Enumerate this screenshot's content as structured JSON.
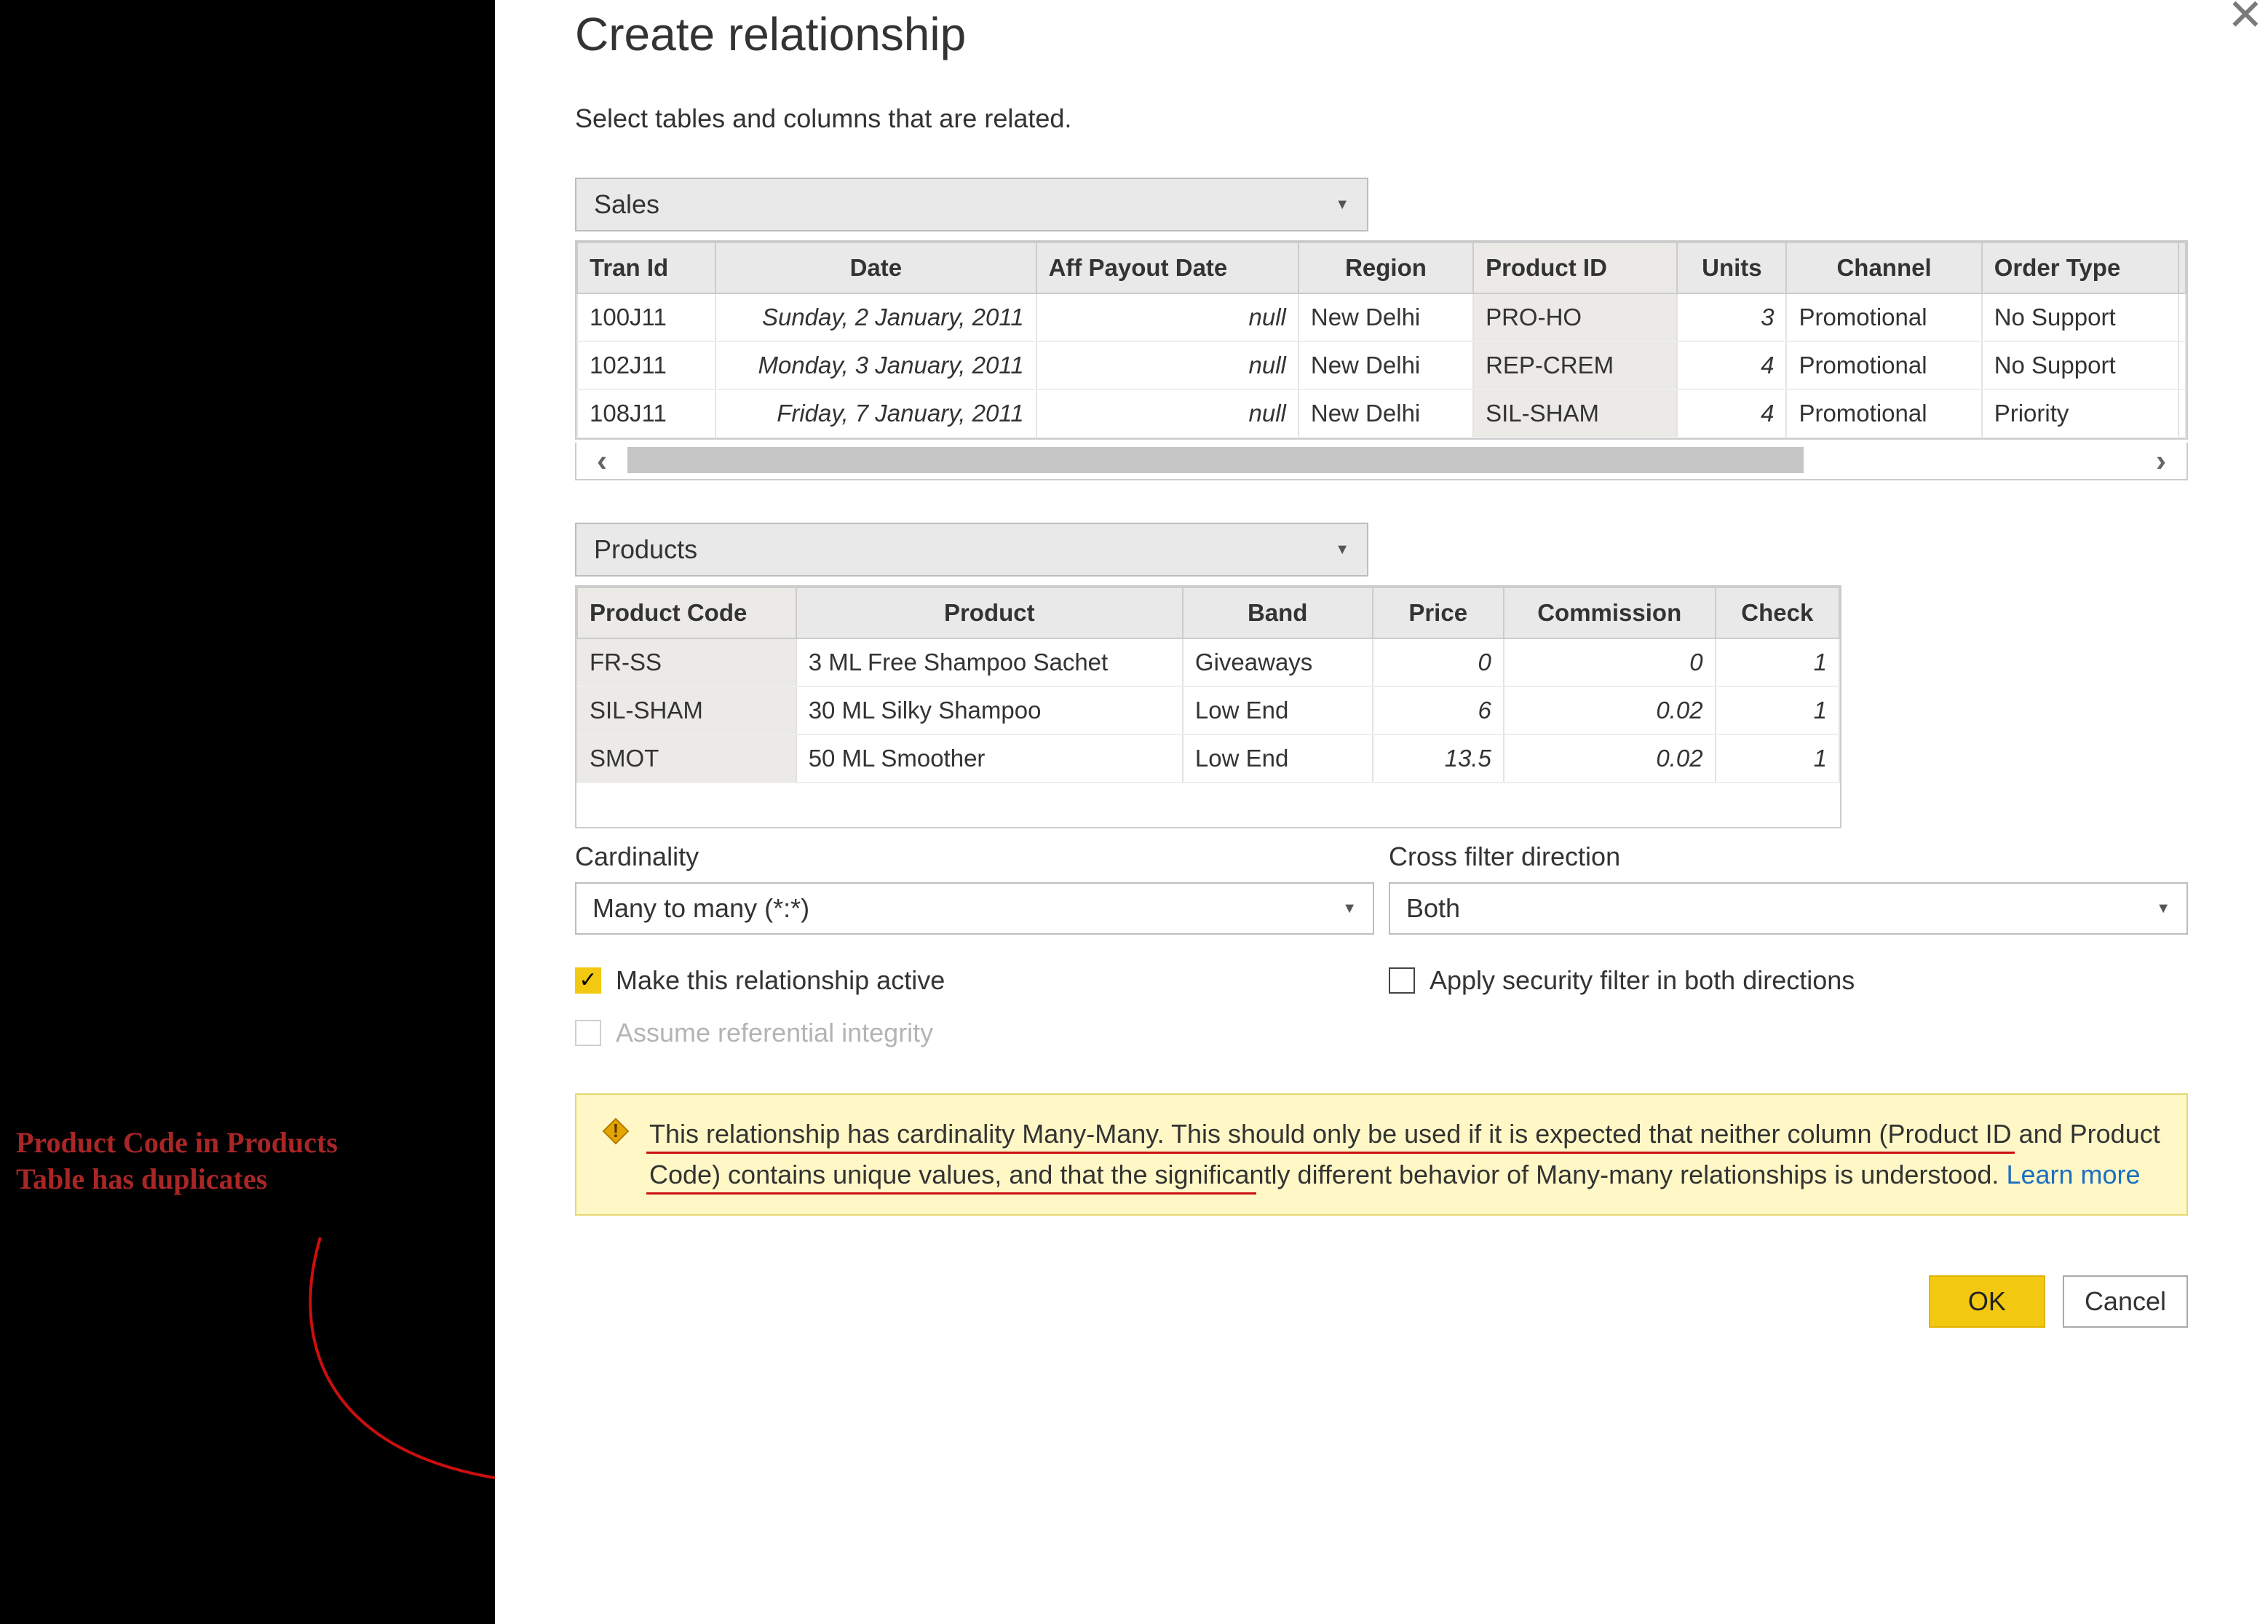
{
  "dialog": {
    "title": "Create relationship",
    "subtitle": "Select tables and columns that are related.",
    "close": "✕"
  },
  "table1": {
    "name": "Sales",
    "headers": [
      "Tran Id",
      "Date",
      "Aff Payout Date",
      "Region",
      "Product ID",
      "Units",
      "Channel",
      "Order Type"
    ],
    "rows": [
      {
        "id": "100J11",
        "date": "Sunday, 2 January, 2011",
        "aff": "null",
        "region": "New Delhi",
        "pid": "PRO-HO",
        "units": "3",
        "channel": "Promotional",
        "otype": "No Support"
      },
      {
        "id": "102J11",
        "date": "Monday, 3 January, 2011",
        "aff": "null",
        "region": "New Delhi",
        "pid": "REP-CREM",
        "units": "4",
        "channel": "Promotional",
        "otype": "No Support"
      },
      {
        "id": "108J11",
        "date": "Friday, 7 January, 2011",
        "aff": "null",
        "region": "New Delhi",
        "pid": "SIL-SHAM",
        "units": "4",
        "channel": "Promotional",
        "otype": "Priority"
      }
    ]
  },
  "table2": {
    "name": "Products",
    "headers": [
      "Product Code",
      "Product",
      "Band",
      "Price",
      "Commission",
      "Check"
    ],
    "rows": [
      {
        "code": "FR-SS",
        "product": "3 ML Free Shampoo Sachet",
        "band": "Giveaways",
        "price": "0",
        "comm": "0",
        "check": "1"
      },
      {
        "code": "SIL-SHAM",
        "product": "30 ML Silky Shampoo",
        "band": "Low End",
        "price": "6",
        "comm": "0.02",
        "check": "1"
      },
      {
        "code": "SMOT",
        "product": "50 ML Smoother",
        "band": "Low End",
        "price": "13.5",
        "comm": "0.02",
        "check": "1"
      }
    ]
  },
  "cardinality": {
    "label": "Cardinality",
    "value": "Many to many (*:*)"
  },
  "crossfilter": {
    "label": "Cross filter direction",
    "value": "Both"
  },
  "checks": {
    "active": "Make this relationship active",
    "assume": "Assume referential integrity",
    "security": "Apply security filter in both directions"
  },
  "warning": {
    "text_a": "This relationship has cardinality Many-Many. This should only be used if it is expected that neither column (Product ",
    "text_b": "ID and Product Code) contains unique values, and that the significantly different behavior of Many-many ",
    "text_c": "relationships is understood.  ",
    "learn": "Learn more"
  },
  "buttons": {
    "ok": "OK",
    "cancel": "Cancel"
  },
  "annotation": {
    "l1a": "Product Code",
    "l1b": " in Products",
    "l2a": "Table has ",
    "l2b": "duplicates"
  }
}
